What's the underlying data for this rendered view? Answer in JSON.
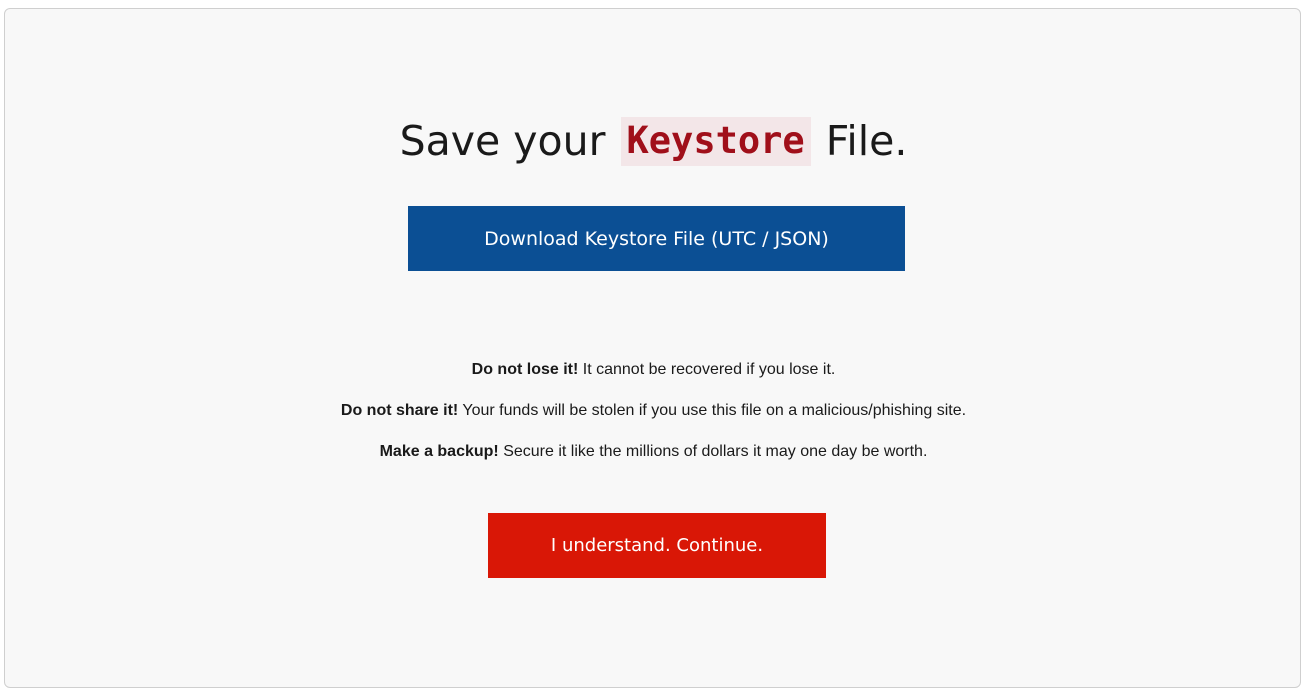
{
  "heading": {
    "prefix": "Save your ",
    "highlight": "Keystore",
    "suffix": " File."
  },
  "download_button": {
    "label": "Download Keystore File (UTC / JSON)"
  },
  "warnings": [
    {
      "bold": "Do not lose it!",
      "text": " It cannot be recovered if you lose it."
    },
    {
      "bold": "Do not share it!",
      "text": " Your funds will be stolen if you use this file on a malicious/phishing site."
    },
    {
      "bold": "Make a backup!",
      "text": " Secure it like the millions of dollars it may one day be worth."
    }
  ],
  "continue_button": {
    "label": "I understand. Continue."
  },
  "colors": {
    "download_button_bg": "#0b4f94",
    "continue_button_bg": "#d91706",
    "highlight_text": "#a00f1a",
    "highlight_bg": "#f3e6e8"
  }
}
